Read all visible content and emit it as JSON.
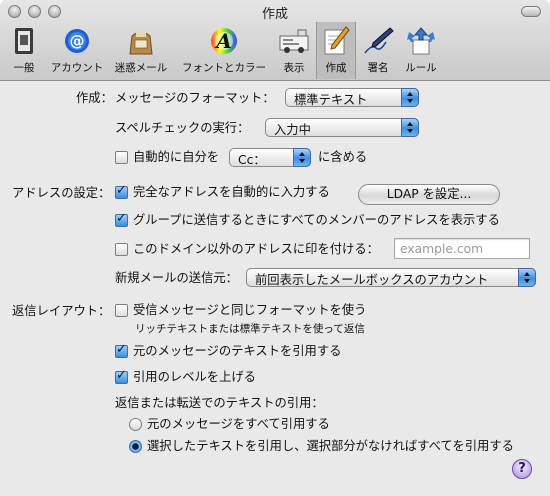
{
  "window": {
    "title": "作成"
  },
  "toolbar": {
    "items": [
      {
        "label": "一般",
        "icon": "switch-icon",
        "selected": false
      },
      {
        "label": "アカウント",
        "icon": "at-sign-icon",
        "selected": false
      },
      {
        "label": "迷惑メール",
        "icon": "junk-mail-bag-icon",
        "selected": false
      },
      {
        "label": "フォントとカラー",
        "icon": "font-color-icon",
        "selected": false
      },
      {
        "label": "表示",
        "icon": "viewing-icon",
        "selected": false
      },
      {
        "label": "作成",
        "icon": "pencil-paper-icon",
        "selected": true
      },
      {
        "label": "署名",
        "icon": "signature-pen-icon",
        "selected": false
      },
      {
        "label": "ルール",
        "icon": "rules-arrows-icon",
        "selected": false
      }
    ]
  },
  "compose": {
    "section_label": "作成：",
    "format_label": "メッセージのフォーマット：",
    "format_value": "標準テキスト",
    "spell_label": "スペルチェックの実行：",
    "spell_value": "入力中",
    "self_prefix": "自動的に自分を",
    "self_value": "Cc：",
    "self_suffix": "に含める",
    "self_checked": false
  },
  "addressing": {
    "section_label": "アドレスの設定：",
    "complete_label": "完全なアドレスを自動的に入力する",
    "complete_checked": true,
    "ldap_button": "LDAP を設定...",
    "group_label": "グループに送信するときにすべてのメンバーのアドレスを表示する",
    "group_checked": true,
    "mark_label": "このドメイン以外のアドレスに印を付ける：",
    "mark_checked": false,
    "mark_placeholder": "example.com",
    "send_from_label": "新規メールの送信元：",
    "send_from_value": "前回表示したメールボックスのアカウント"
  },
  "responding": {
    "section_label": "返信レイアウト：",
    "same_format_label": "受信メッセージと同じフォーマットを使う",
    "same_format_checked": false,
    "same_format_note": "リッチテキストまたは標準テキストを使って返信",
    "quote_label": "元のメッセージのテキストを引用する",
    "quote_checked": true,
    "increase_label": "引用のレベルを上げる",
    "increase_checked": true,
    "quote_heading": "返信または転送でのテキストの引用：",
    "radio_all": "元のメッセージをすべて引用する",
    "radio_selected": "選択したテキストを引用し、選択部分がなければすべてを引用する",
    "selected_radio": "radio_selected"
  },
  "help": {
    "label": "?"
  },
  "colors": {
    "accent": "#3f8ee0",
    "window_bg": "#e9e9e9",
    "help_purple": "#b9a0e6"
  }
}
